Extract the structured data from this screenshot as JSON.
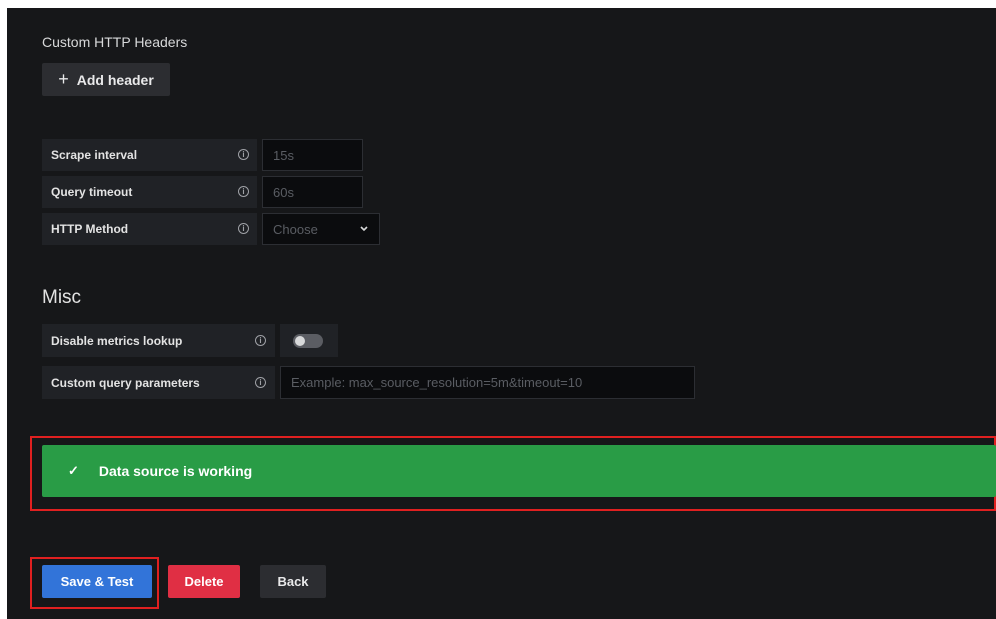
{
  "custom_http_headers": {
    "title": "Custom HTTP Headers",
    "add_button_icon": "+",
    "add_button_label": "Add header"
  },
  "fields": [
    {
      "label": "Scrape interval",
      "placeholder": "15s"
    },
    {
      "label": "Query timeout",
      "placeholder": "60s"
    },
    {
      "label": "HTTP Method",
      "placeholder": "Choose"
    }
  ],
  "misc": {
    "title": "Misc",
    "disable_metrics_label": "Disable metrics lookup",
    "disable_metrics_enabled": false,
    "custom_query_label": "Custom query parameters",
    "custom_query_placeholder": "Example: max_source_resolution=5m&timeout=10"
  },
  "info_icon_glyph": "i",
  "alert": {
    "icon": "✓",
    "message": "Data source is working",
    "color": "#299c46"
  },
  "actions": {
    "save_label": "Save & Test",
    "delete_label": "Delete",
    "back_label": "Back"
  },
  "colors": {
    "background": "#161719",
    "primary": "#3274d9",
    "danger": "#e02f44",
    "highlight_outline": "#e02020"
  }
}
